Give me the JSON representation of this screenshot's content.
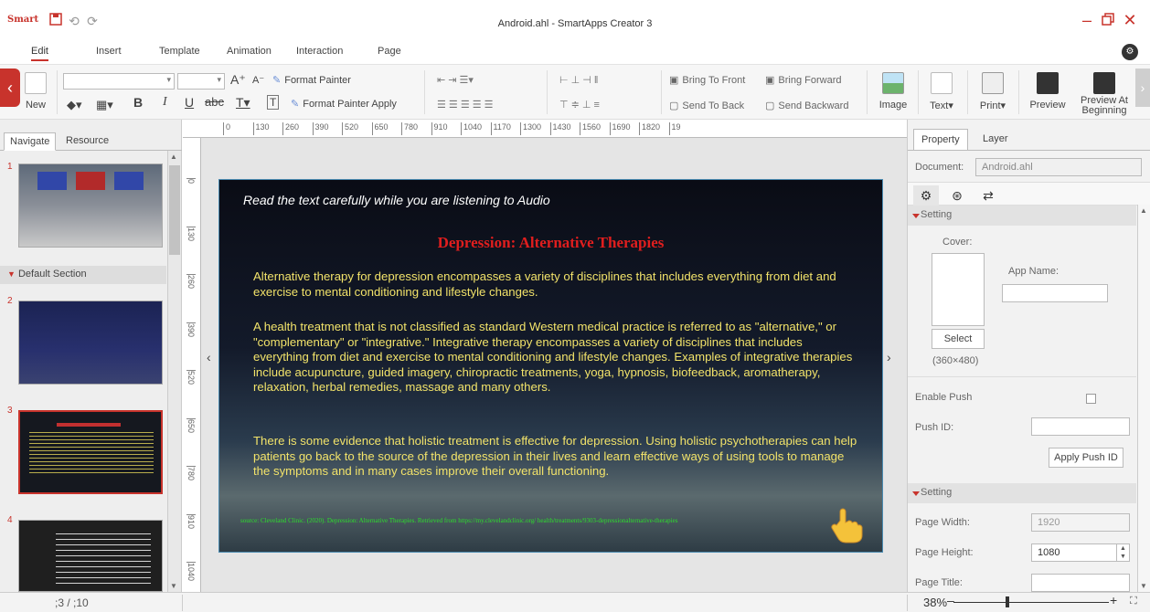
{
  "app": {
    "title": "Android.ahl - SmartApps Creator 3",
    "logo_text": "Smart",
    "qa_icons": [
      "save-icon",
      "undo-icon",
      "redo-icon"
    ],
    "window_controls": [
      "minimize-icon",
      "restore-icon",
      "close-icon"
    ]
  },
  "menu_tabs": [
    "Edit",
    "Insert",
    "Template",
    "Animation",
    "Interaction",
    "Page"
  ],
  "ribbon": {
    "new": "New",
    "format_painter": "Format Painter",
    "format_painter_apply": "Format Painter Apply",
    "bring_to_front": "Bring To Front",
    "bring_forward": "Bring Forward",
    "send_to_back": "Send To Back",
    "send_backward": "Send Backward",
    "image": "Image",
    "text": "Text",
    "print": "Print",
    "preview": "Preview",
    "preview_at_1": "Preview At",
    "preview_at_2": "Beginning"
  },
  "left_panel": {
    "tabs": [
      "Navigate",
      "Resource"
    ],
    "section": "Default Section",
    "thumb_numbers": [
      "1",
      "2",
      "3",
      "4"
    ]
  },
  "rulers": {
    "h_ticks": [
      "0",
      "130",
      "260",
      "390",
      "520",
      "650",
      "780",
      "910",
      "1040",
      "1170",
      "1300",
      "1430",
      "1560",
      "1690",
      "1820",
      "19"
    ],
    "v_ticks": [
      "0",
      "130",
      "260",
      "390",
      "520",
      "650",
      "780",
      "910",
      "1040"
    ]
  },
  "slide": {
    "header": "Read the text carefully while you are listening to Audio",
    "title": "Depression: Alternative Therapies",
    "para1": "Alternative therapy for depression encompasses a variety of disciplines that includes everything from diet and exercise to mental conditioning and lifestyle changes.",
    "para2": "A health treatment that is not classified as standard Western medical practice is  referred to as \"alternative,\" or \"complementary\" or \"integrative.\" Integrative therapy encompasses a variety of disciplines that includes everything from diet and exercise to mental conditioning and lifestyle changes. Examples of integrative therapies include acupuncture, guided imagery, chiropractic treatments, yoga, hypnosis, biofeedback, aromatherapy, relaxation, herbal remedies, massage and many others.",
    "para3": "There is some evidence that holistic treatment is effective for depression. Using holistic psychotherapies can help patients go back to the source of the depression in their lives and learn effective ways of using tools to manage the symptoms and in many cases improve their overall functioning.",
    "source": "source: Cleveland Clinic. (2020). Depression: Alternative Therapies. Retrieved from https://my.clevelandclinic.org/ health/treatments/9303-depressionalternative-therapies"
  },
  "right_panel": {
    "tabs": [
      "Property",
      "Layer"
    ],
    "document_label": "Document:",
    "document_value": "Android.ahl",
    "setting1": "Setting",
    "cover_label": "Cover:",
    "app_name_label": "App Name:",
    "select_btn": "Select",
    "cover_size": "(360×480)",
    "enable_push": "Enable Push",
    "push_id_label": "Push ID:",
    "apply_push_btn": "Apply Push ID",
    "setting2": "Setting",
    "page_width_label": "Page Width:",
    "page_width_value": "1920",
    "page_height_label": "Page Height:",
    "page_height_value": "1080",
    "page_title_label": "Page Title:"
  },
  "status": {
    "page_counter": ";3  /  ;10",
    "zoom": "38%"
  }
}
